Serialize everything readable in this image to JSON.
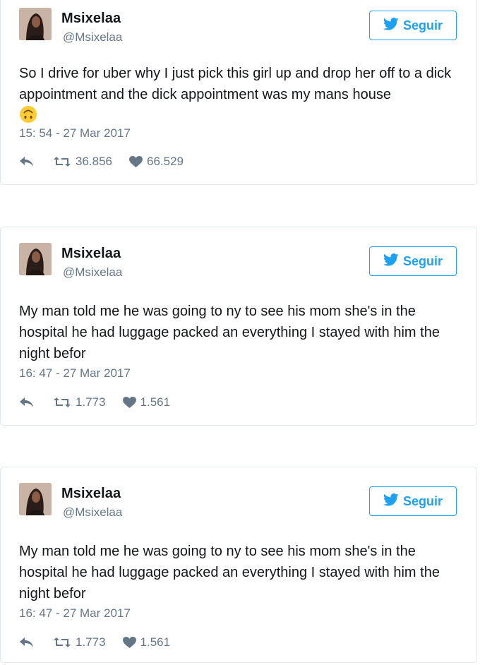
{
  "tweets": [
    {
      "display_name": "Msixelaa",
      "handle": "@Msixelaa",
      "follow_label": "Seguir",
      "text": "So I drive for uber why I just pick this girl up and drop her off to a dick appointment and the dick appointment was my mans house",
      "emoji": "upside-down-face",
      "timestamp": "15: 54 - 27 Mar 2017",
      "retweets": "36.856",
      "likes": "66.529"
    },
    {
      "display_name": "Msixelaa",
      "handle": "@Msixelaa",
      "follow_label": "Seguir",
      "text": "My man told me he was going to ny to see his mom she's in the hospital he had luggage packed an everything I stayed with him the night befor",
      "timestamp": "16: 47 - 27 Mar 2017",
      "retweets": "1.773",
      "likes": "1.561"
    },
    {
      "display_name": "Msixelaa",
      "handle": "@Msixelaa",
      "follow_label": "Seguir",
      "text": "My man told me he was going to ny to see his mom she's in the hospital he had luggage packed an everything I stayed with him the night befor",
      "timestamp": "16: 47 - 27 Mar 2017",
      "retweets": "1.773",
      "likes": "1.561"
    }
  ],
  "icons": {
    "follow": "twitter-bird-icon",
    "reply": "reply-icon",
    "retweet": "retweet-icon",
    "like": "heart-icon"
  },
  "colors": {
    "accent": "#1da1f2",
    "secondary_text": "#657786",
    "primary_text": "#14171a",
    "border": "#e1e8ed"
  }
}
